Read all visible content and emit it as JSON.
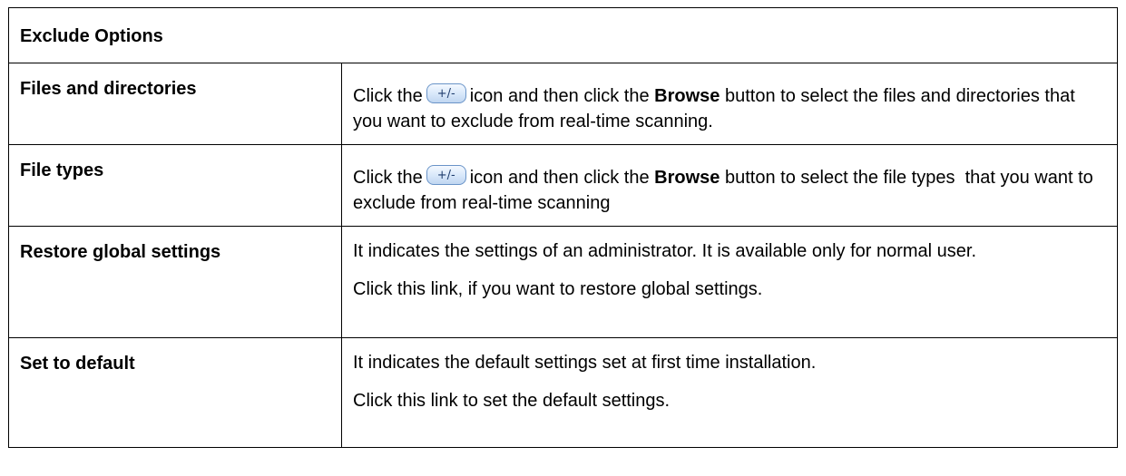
{
  "table": {
    "header": "Exclude Options",
    "rows": [
      {
        "label": "Files and directories",
        "pre": "Click the",
        "icon_text": "+/-",
        "mid": "icon and then click the",
        "bold": "Browse",
        "post": "button to select the files and directories that you want to exclude from real-time scanning."
      },
      {
        "label": "File types",
        "pre": "Click the",
        "icon_text": "+/-",
        "mid": "icon and then click the",
        "bold": "Browse",
        "post": "button to select the file types  that you want to exclude from real-time scanning"
      },
      {
        "label": "Restore global settings",
        "para1": "It indicates the settings of an administrator. It is available only for normal user.",
        "para2": "Click this link, if you want to restore global settings."
      },
      {
        "label": "Set to default",
        "para1": "It indicates the default settings set at first time installation.",
        "para2": "Click this link to set the default settings."
      }
    ]
  }
}
